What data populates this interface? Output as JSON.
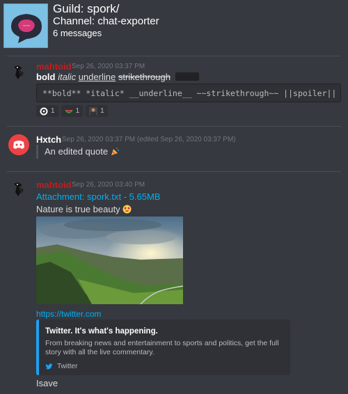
{
  "header": {
    "guild": "Guild: spork/",
    "channel": "Channel: chat-exporter",
    "count": "6 messages"
  },
  "messages": [
    {
      "author": "mahtoid",
      "author_color": "#c71c1c",
      "timestamp": "Sep 26, 2020 03:37 PM",
      "bold": "bold",
      "italic": "italic",
      "underline": "underline",
      "strike": "strikethrough",
      "code": "**bold** *italic* __underline__ ~~strikethrough~~ ||spoiler||",
      "reactions": [
        {
          "emoji": "target-emoji",
          "count": "1"
        },
        {
          "emoji": "watermelon-emoji",
          "count": "1"
        },
        {
          "emoji": "custom-emoji",
          "count": "1"
        }
      ]
    },
    {
      "author": "Hxtch",
      "author_color": "#ffffff",
      "timestamp": "Sep 26, 2020 03:37 PM",
      "edited": "(edited Sep 26, 2020 03:37 PM)",
      "quote": "An edited quote"
    },
    {
      "author": "mahtoid",
      "author_color": "#c71c1c",
      "timestamp": "Sep 26, 2020 03:40 PM",
      "attachment": "Attachment: spork.txt - 5.65MB",
      "text": "Nature is true beauty",
      "link": "https://twitter.com",
      "embed": {
        "title": "Twitter. It's what's happening.",
        "description": "From breaking news and entertainment to sports and politics, get the full story with all the live commentary.",
        "footer": "Twitter",
        "color": "#1da1f2"
      },
      "last_text": "Isave"
    }
  ],
  "colors": {
    "background": "#36393f",
    "link": "#00b0f4",
    "discord_red": "#ed4245"
  }
}
